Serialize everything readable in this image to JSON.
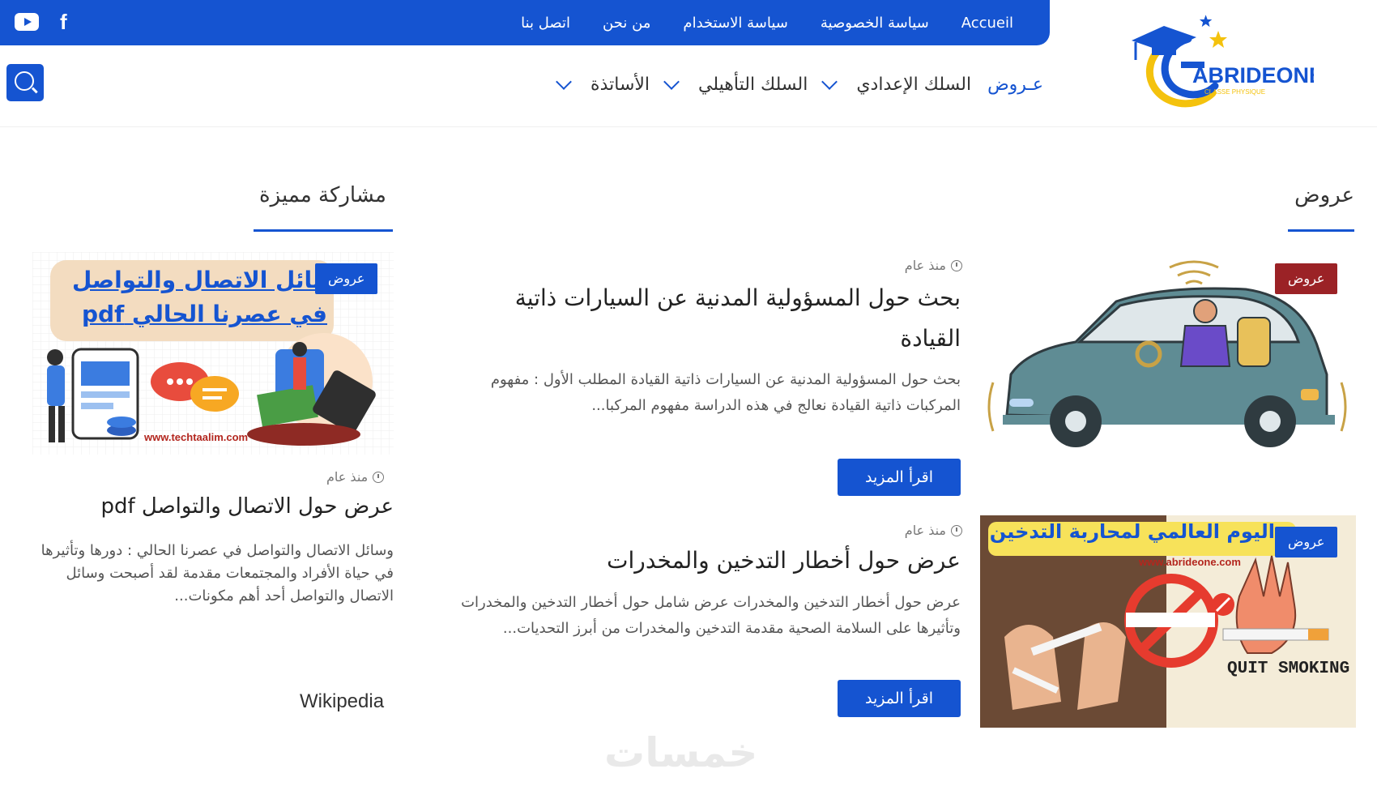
{
  "header": {
    "top_links": [
      "Accueil",
      "سياسة الخصوصية",
      "سياسة الاستخدام",
      "من نحن",
      "اتصل بنا"
    ],
    "social": [
      {
        "icon": "youtube-icon"
      },
      {
        "icon": "facebook-icon"
      }
    ],
    "logo_text": "ABRIDEONE",
    "logo_subtext": "CLASSE PHYSIQUE",
    "colors": {
      "brand": "#1554d1",
      "badge_red": "#9b2226",
      "badge_blue": "#1554d1"
    }
  },
  "nav": {
    "items": [
      {
        "label": "عـروض",
        "active": true,
        "dropdown": false
      },
      {
        "label": "السلك الإعدادي",
        "active": false,
        "dropdown": true
      },
      {
        "label": "السلك التأهيلي",
        "active": false,
        "dropdown": true
      },
      {
        "label": "الأساتذة",
        "active": false,
        "dropdown": true
      }
    ],
    "search_icon": "search-icon"
  },
  "main": {
    "section_title": "عروض",
    "posts": [
      {
        "badge": "عروض",
        "time": "منذ عام",
        "title": "بحث حول المسؤولية المدنية عن السيارات ذاتية القيادة",
        "excerpt": "بحث حول المسؤولية المدنية عن السيارات ذاتية القيادة المطلب الأول : مفهوم المركبات ذاتية القيادة نعالج في هذه الدراسة مفهوم المركبا...",
        "more": "اقرأ المزيد"
      },
      {
        "badge": "عروض",
        "time": "منذ عام",
        "title": "عرض حول أخطار التدخين والمخدرات",
        "excerpt": "عرض حول أخطار التدخين والمخدرات عرض شامل حول أخطار التدخين والمخدرات وتأثيرها على السلامة الصحية مقدمة التدخين والمخدرات من أبرز التحديات...",
        "more": "اقرأ المزيد",
        "image_heading": "اليوم العالمي لمحاربة التدخين",
        "image_url_text": "www.abrideone.com",
        "image_caption": "QUIT SMOKING"
      }
    ]
  },
  "sidebar": {
    "section_title": "مشاركة مميزة",
    "featured": {
      "badge": "عروض",
      "time": "منذ عام",
      "title": "عرض حول الاتصال والتواصل pdf",
      "excerpt": "وسائل الاتصال والتواصل في عصرنا الحالي : دورها وتأثيرها في حياة الأفراد والمجتمعات مقدمة لقد أصبحت وسائل الاتصال والتواصل أحد أهم مكونات...",
      "image_line1": "وسائل الاتصال والتواصل",
      "image_line2": "في عصرنا الحالي pdf",
      "image_url_text": "www.techtaalim.com"
    },
    "wiki_title": "Wikipedia"
  },
  "watermark": "خمسات"
}
